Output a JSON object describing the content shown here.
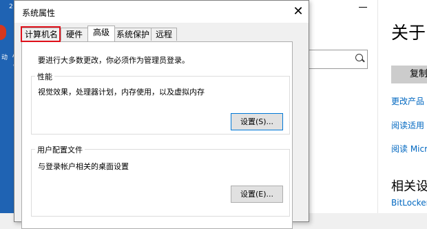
{
  "desktop": {
    "icon_number": "2",
    "tag_left": "动",
    "tag_right_top": "A",
    "tag_right_bottom": "é"
  },
  "settings_window": {
    "heading": "关于",
    "copy_button": "复制",
    "links": [
      "更改产品",
      "阅读适用",
      "阅读 Micr",
      "BitLocker"
    ],
    "related_heading": "相关设"
  },
  "dialog": {
    "title": "系统属性",
    "close_glyph": "✕",
    "tabs": [
      {
        "label": "计算机名"
      },
      {
        "label": "硬件"
      },
      {
        "label": "高级"
      },
      {
        "label": "系统保护"
      },
      {
        "label": "远程"
      }
    ],
    "active_tab": "高级",
    "highlighted_tab": "计算机名",
    "highlight_color": "#e0101a",
    "admin_note": "要进行大多数更改，你必须作为管理员登录。",
    "performance": {
      "label": "性能",
      "description": "视觉效果，处理器计划，内存使用，以及虚拟内存",
      "button": "设置(S)..."
    },
    "user_profiles": {
      "label": "用户配置文件",
      "description": "与登录帐户相关的桌面设置",
      "button": "设置(E)..."
    }
  },
  "colors": {
    "desktop_blue": "#1f63b3",
    "link_blue": "#0067c0",
    "focus_border": "#0078d7"
  }
}
